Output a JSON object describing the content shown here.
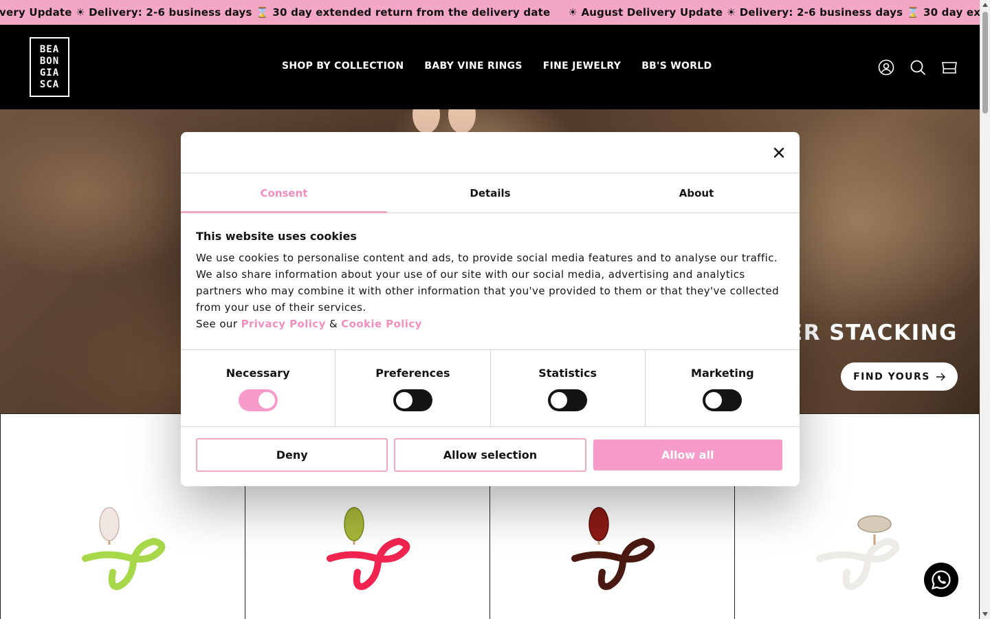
{
  "announcement": {
    "items": [
      "very Update ☀ Delivery: 2-6 business days ⌛ 30 day extended return from the delivery date",
      "☀ August Delivery Update ☀ Delivery: 2-6 business days ⌛ 30 day ext"
    ]
  },
  "header": {
    "logo_lines": [
      "BEA",
      "BON",
      "GIA",
      "SCA"
    ],
    "nav": [
      "SHOP BY COLLECTION",
      "BABY VINE RINGS",
      "FINE JEWELRY",
      "BB'S WORLD"
    ],
    "icons": [
      "account-icon",
      "search-icon",
      "cart-icon"
    ]
  },
  "hero": {
    "title": "ER STACKING",
    "button_label": "FIND YOURS"
  },
  "products": [
    {
      "name": "ring-lime",
      "enamel_color": "#a6d84a",
      "stone_color": "#f2e6e2"
    },
    {
      "name": "ring-pink",
      "enamel_color": "#f0244f",
      "stone_color": "#a8b83a"
    },
    {
      "name": "ring-brown",
      "enamel_color": "#4a1a12",
      "stone_color": "#8c1a14"
    },
    {
      "name": "ring-white",
      "enamel_color": "#ecebe6",
      "stone_color": "#d6cab8"
    }
  ],
  "cookie_dialog": {
    "tabs": [
      "Consent",
      "Details",
      "About"
    ],
    "active_tab": "Consent",
    "title": "This website uses cookies",
    "text": "We use cookies to personalise content and ads, to provide social media features and to analyse our traffic. We also share information about your use of our site with our social media, advertising and analytics partners who may combine it with other information that you've provided to them or that they've collected from your use of their services.",
    "see_our": "See our",
    "privacy_link": "Privacy Policy",
    "amp": "&",
    "cookie_link": "Cookie Policy",
    "categories": [
      {
        "label": "Necessary",
        "enabled": true
      },
      {
        "label": "Preferences",
        "enabled": false
      },
      {
        "label": "Statistics",
        "enabled": false
      },
      {
        "label": "Marketing",
        "enabled": false
      }
    ],
    "buttons": {
      "deny": "Deny",
      "allow_selection": "Allow selection",
      "allow_all": "Allow all"
    },
    "accent_color": "#f79cca"
  }
}
